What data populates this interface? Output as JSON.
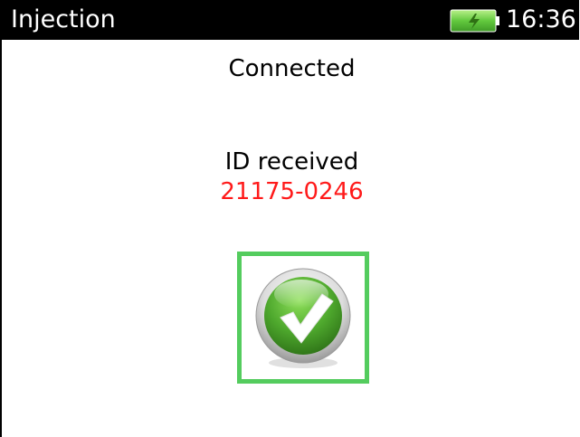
{
  "header": {
    "title": "Injection",
    "time": "16:36",
    "battery_icon": "battery-charging-icon"
  },
  "status": {
    "connection": "Connected",
    "id_label": "ID received",
    "id_value": "21175-0246",
    "result_icon": "success-checkmark-icon"
  },
  "colors": {
    "header_background": "#000000",
    "id_value": "#ff1a1a",
    "success_frame": "#54cc5e",
    "battery_fill": "#58c63a"
  }
}
